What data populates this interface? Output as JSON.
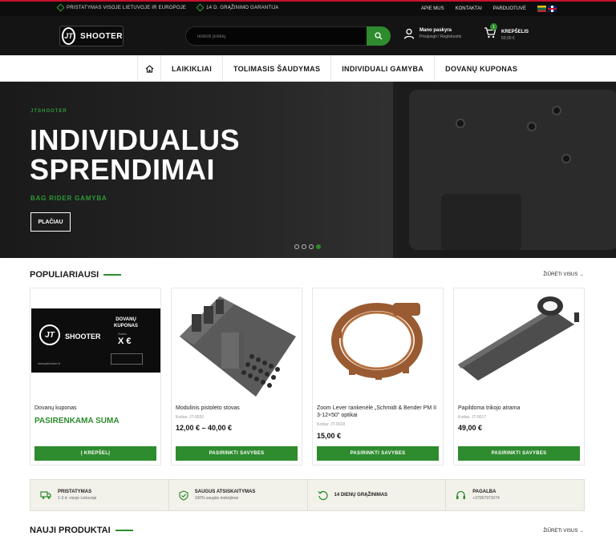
{
  "topbar": {
    "items": [
      "PRISTATYMAS VISOJE LIETUVOJE IR EUROPOJE",
      "14 D. GRĄŽINIMO GARANTIJA"
    ],
    "links": [
      "APIE MUS",
      "KONTAKTAI",
      "PARDUOTUVĖ"
    ]
  },
  "header": {
    "logo_mark": "JT",
    "logo_text": "SHOOTER",
    "search_placeholder": "Ieškoti prekių",
    "account_title": "Mano paskyra",
    "account_sub": "Prisijungti / Registruotis",
    "cart_count": "1",
    "cart_title": "KREPŠELIS",
    "cart_total": "50,00 €"
  },
  "nav": {
    "items": [
      "LAIKIKLIAI",
      "TOLIMASIS ŠAUDYMAS",
      "INDIVIDUALI GAMYBA",
      "DOVANŲ KUPONAS"
    ]
  },
  "hero": {
    "tagline": "JTSHOOTER",
    "title": "INDIVIDUALUS SPRENDIMAI",
    "subtitle": "BAG RIDER GAMYBA",
    "cta": "PLAČIAU"
  },
  "popular": {
    "title": "POPULIARIAUSI",
    "view_all": "ŽIŪRĖTI VISUS →"
  },
  "products": [
    {
      "name": "Dovanų kuponas",
      "promo": "PASIRENKAMA SUMA",
      "button": "Į KREPŠELĮ",
      "voucher": {
        "title1": "DOVANŲ",
        "title2": "KUPONAS",
        "suma": "Suma",
        "amount": "X €",
        "site": "www.jtshooter.lt"
      }
    },
    {
      "name": "Modulinis pistoleto stovas",
      "code": "Kodas: JT-0020",
      "price": "12,00 € – 40,00 €",
      "button": "PASIRINKTI SAVYBES"
    },
    {
      "name": "Zoom Lever rankenėlė „Schmidt & Bender PM II 3-12×50\" optikai",
      "code": "Kodas: JT-0018",
      "price": "15,00 €",
      "button": "PASIRINKTI SAVYBES"
    },
    {
      "name": "Papildoma trikojo atrama",
      "code": "Kodas: JT-0017",
      "price": "49,00 €",
      "button": "PASIRINKTI SAVYBES"
    }
  ],
  "benefits": [
    {
      "title": "PRISTATYMAS",
      "sub": "1-3 d. visoje Lietuvoje",
      "icon": "truck-icon"
    },
    {
      "title": "SAUGUS ATSISKAITYMAS",
      "sub": "100% saugūs mokėjimai",
      "icon": "shield-check-icon"
    },
    {
      "title": "14 DIENŲ GRĄŽINIMAS",
      "sub": "",
      "icon": "return-icon"
    },
    {
      "title": "PAGALBA",
      "sub": "+37067971074",
      "icon": "headset-icon"
    }
  ],
  "new_products": {
    "title": "NAUJI PRODUKTAI",
    "view_all": "ŽIŪRĖTI VISUS →"
  },
  "colors": {
    "accent": "#2e8b2e",
    "header_bg": "#141414",
    "topbar_line": "#c8102e"
  }
}
